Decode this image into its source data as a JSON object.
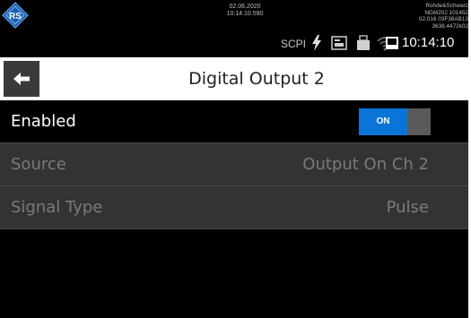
{
  "status_bar": {
    "date": "02.06.2020",
    "time_precise": "10:14:10.590",
    "device_info": [
      "Rohde&Schwarz",
      "NGM202 101452",
      "02.016 03F38AB13",
      "3638.4472k02"
    ],
    "scpi_label": "SCPI",
    "clock": "10:14:10",
    "icons": [
      "rs-logo-icon",
      "lightning-icon",
      "lan-icon",
      "usb-icon",
      "wifi-icon",
      "screen-icon"
    ]
  },
  "title_bar": {
    "back_icon": "arrow-left-icon",
    "title": "Digital Output 2"
  },
  "settings": {
    "enabled": {
      "label": "Enabled",
      "toggle_label": "ON",
      "state": "on"
    },
    "source": {
      "label": "Source",
      "value": "Output On Ch 2"
    },
    "signal_type": {
      "label": "Signal Type",
      "value": "Pulse"
    }
  },
  "colors": {
    "accent": "#0a74d9",
    "title_background": "#ffffff",
    "row_background": "#333333",
    "disabled_text": "#7a7a7a"
  }
}
